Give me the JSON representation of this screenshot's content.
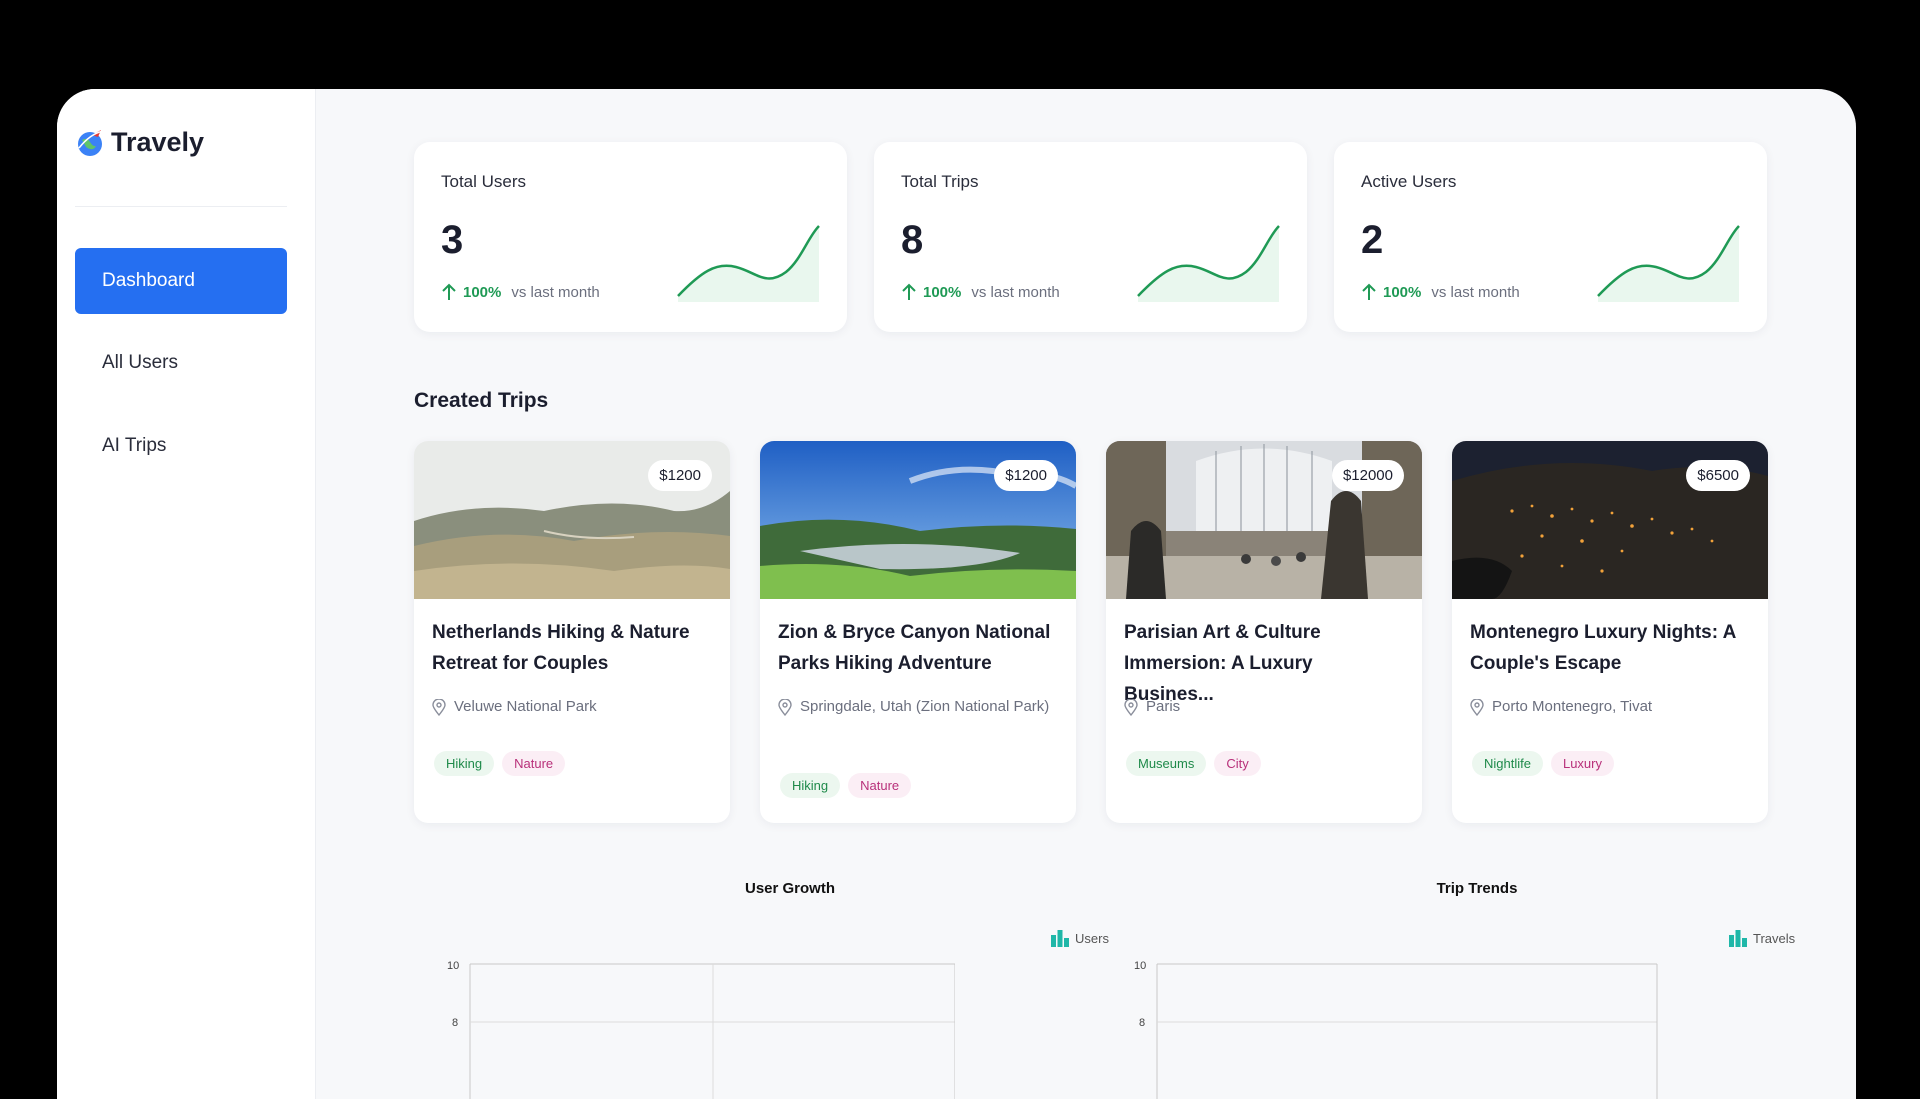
{
  "app": {
    "name": "Travely"
  },
  "sidebar": {
    "items": [
      {
        "label": "Dashboard",
        "active": true
      },
      {
        "label": "All Users",
        "active": false
      },
      {
        "label": "AI Trips",
        "active": false
      }
    ]
  },
  "stats": [
    {
      "title": "Total Users",
      "value": "3",
      "change": "100%",
      "comparison": "vs last month"
    },
    {
      "title": "Total Trips",
      "value": "8",
      "change": "100%",
      "comparison": "vs last month"
    },
    {
      "title": "Active Users",
      "value": "2",
      "change": "100%",
      "comparison": "vs last month"
    }
  ],
  "trips_section": {
    "title": "Created Trips",
    "trips": [
      {
        "name": "Netherlands Hiking & Nature Retreat for Couples",
        "price": "$1200",
        "location": "Veluwe National Park",
        "tags": [
          "Hiking",
          "Nature"
        ],
        "scene": "dunes"
      },
      {
        "name": "Zion & Bryce Canyon National Parks Hiking Adventure",
        "price": "$1200",
        "location": "Springdale, Utah (Zion National Park)",
        "tags": [
          "Hiking",
          "Nature"
        ],
        "scene": "lake"
      },
      {
        "name": "Parisian Art & Culture Immersion: A Luxury Busines...",
        "price": "$12000",
        "location": "Paris",
        "tags": [
          "Museums",
          "City"
        ],
        "scene": "museum"
      },
      {
        "name": "Montenegro Luxury Nights: A Couple's Escape",
        "price": "$6500",
        "location": "Porto Montenegro, Tivat",
        "tags": [
          "Nightlife",
          "Luxury"
        ],
        "scene": "night"
      }
    ]
  },
  "charts": {
    "user_growth": {
      "title": "User Growth",
      "legend": "Users",
      "ticks": [
        "10",
        "8"
      ]
    },
    "trip_trends": {
      "title": "Trip Trends",
      "legend": "Travels",
      "ticks": [
        "10",
        "8"
      ]
    }
  },
  "colors": {
    "accent": "#256ff1",
    "positive": "#1f9a55",
    "legend": "#1fb7a8"
  }
}
